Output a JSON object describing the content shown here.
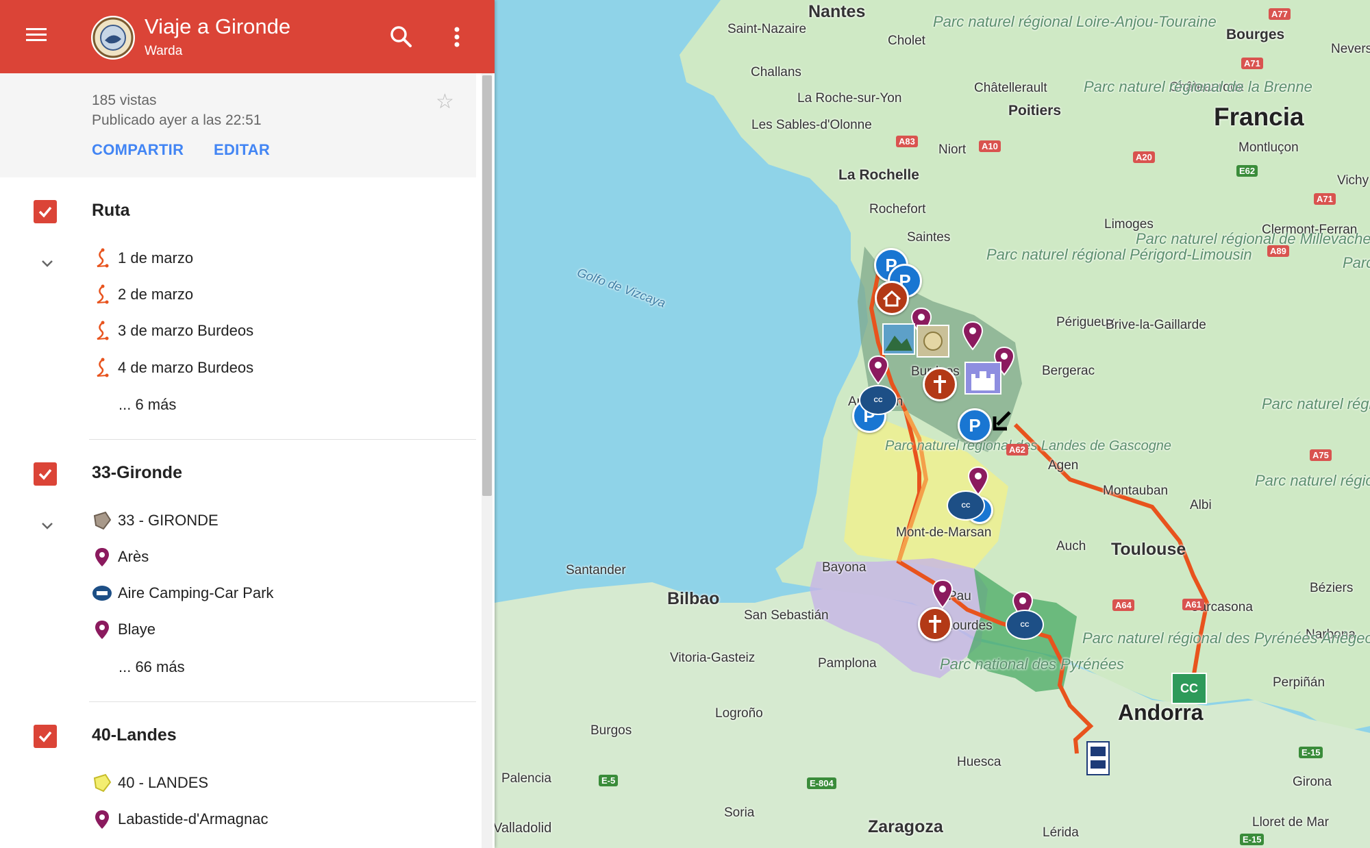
{
  "header": {
    "title": "Viaje a Gironde",
    "owner": "Warda"
  },
  "info": {
    "views": "185 vistas",
    "published": "Publicado ayer a las 22:51",
    "share_label": "COMPARTIR",
    "edit_label": "EDITAR"
  },
  "layers": [
    {
      "title": "Ruta",
      "items": [
        {
          "label": "1 de marzo",
          "icon": "route-icon"
        },
        {
          "label": "2 de marzo",
          "icon": "route-icon"
        },
        {
          "label": "3 de marzo Burdeos",
          "icon": "route-icon"
        },
        {
          "label": "4 de marzo Burdeos",
          "icon": "route-icon"
        }
      ],
      "more": "... 6 más"
    },
    {
      "title": "33-Gironde",
      "items": [
        {
          "label": "33 - GIRONDE",
          "icon": "polygon-icon"
        },
        {
          "label": "Arès",
          "icon": "pin-icon"
        },
        {
          "label": "Aire Camping-Car Park",
          "icon": "camping-car-icon"
        },
        {
          "label": "Blaye",
          "icon": "pin-icon"
        }
      ],
      "more": "... 66 más"
    },
    {
      "title": "40-Landes",
      "items": [
        {
          "label": "40 - LANDES",
          "icon": "polygon-icon"
        },
        {
          "label": "Labastide-d'Armagnac",
          "icon": "pin-icon"
        }
      ]
    }
  ],
  "map": {
    "country_labels": [
      "Francia",
      "Andorra"
    ],
    "cities": [
      "Nantes",
      "Saint-Nazaire",
      "Cholet",
      "Challans",
      "La Roche-sur-Yon",
      "Les Sables-d'Olonne",
      "Châtellerault",
      "Poitiers",
      "Bourges",
      "Nevers",
      "Châteauroux",
      "Niort",
      "La Rochelle",
      "Montluçon",
      "Rochefort",
      "Saintes",
      "Limoges",
      "Clermont-Ferran",
      "Vichy",
      "Périgueux",
      "Brive-la-Gaillarde",
      "Bergerac",
      "Agen",
      "Montauban",
      "Albi",
      "Auch",
      "Toulouse",
      "Mont-de-Marsan",
      "Bayona",
      "Pau",
      "Lourdes",
      "Carcasona",
      "Béziers",
      "Narbona",
      "Perpiñán",
      "Santander",
      "Bilbao",
      "San Sebastián",
      "Vitoria-Gasteiz",
      "Pamplona",
      "Logroño",
      "Burgos",
      "Huesca",
      "Palencia",
      "Soria",
      "Zaragoza",
      "Lérida",
      "Girona",
      "Lloret de Mar",
      "Valladolid",
      "Arcachon",
      "Burdeos"
    ],
    "parks": [
      "Parc naturel régional Loire-Anjou-Touraine",
      "Parc naturel régional de la Brenne",
      "Parc naturel régional Périgord-Limousin",
      "Parc naturel régional de Millevaches en Limousin",
      "Parc naturel régional de l'Aubrac",
      "Parc naturel régional des Grands Causses",
      "Parc naturel régional des Pyrénées Ariégeoises",
      "Parc national des Pyrénées",
      "Parc naturel régional des Landes de Gascogne",
      "Parc Livrad"
    ],
    "sea": "Golfo de Vizcaya",
    "roads": [
      "A77",
      "A71",
      "A83",
      "A10",
      "A20",
      "E62",
      "A71",
      "A89",
      "A75",
      "A62",
      "A64",
      "A61",
      "E-5",
      "E-804",
      "E-15",
      "E-15"
    ],
    "colors": {
      "route": "#e8531d",
      "route_light": "#f4a04a",
      "gironde": "#7fa88a",
      "landes": "#f0f08c",
      "pyrenees_atl": "#c6b4e6",
      "hautes_pyrenees": "#4aa964",
      "accent": "#db4437"
    }
  }
}
